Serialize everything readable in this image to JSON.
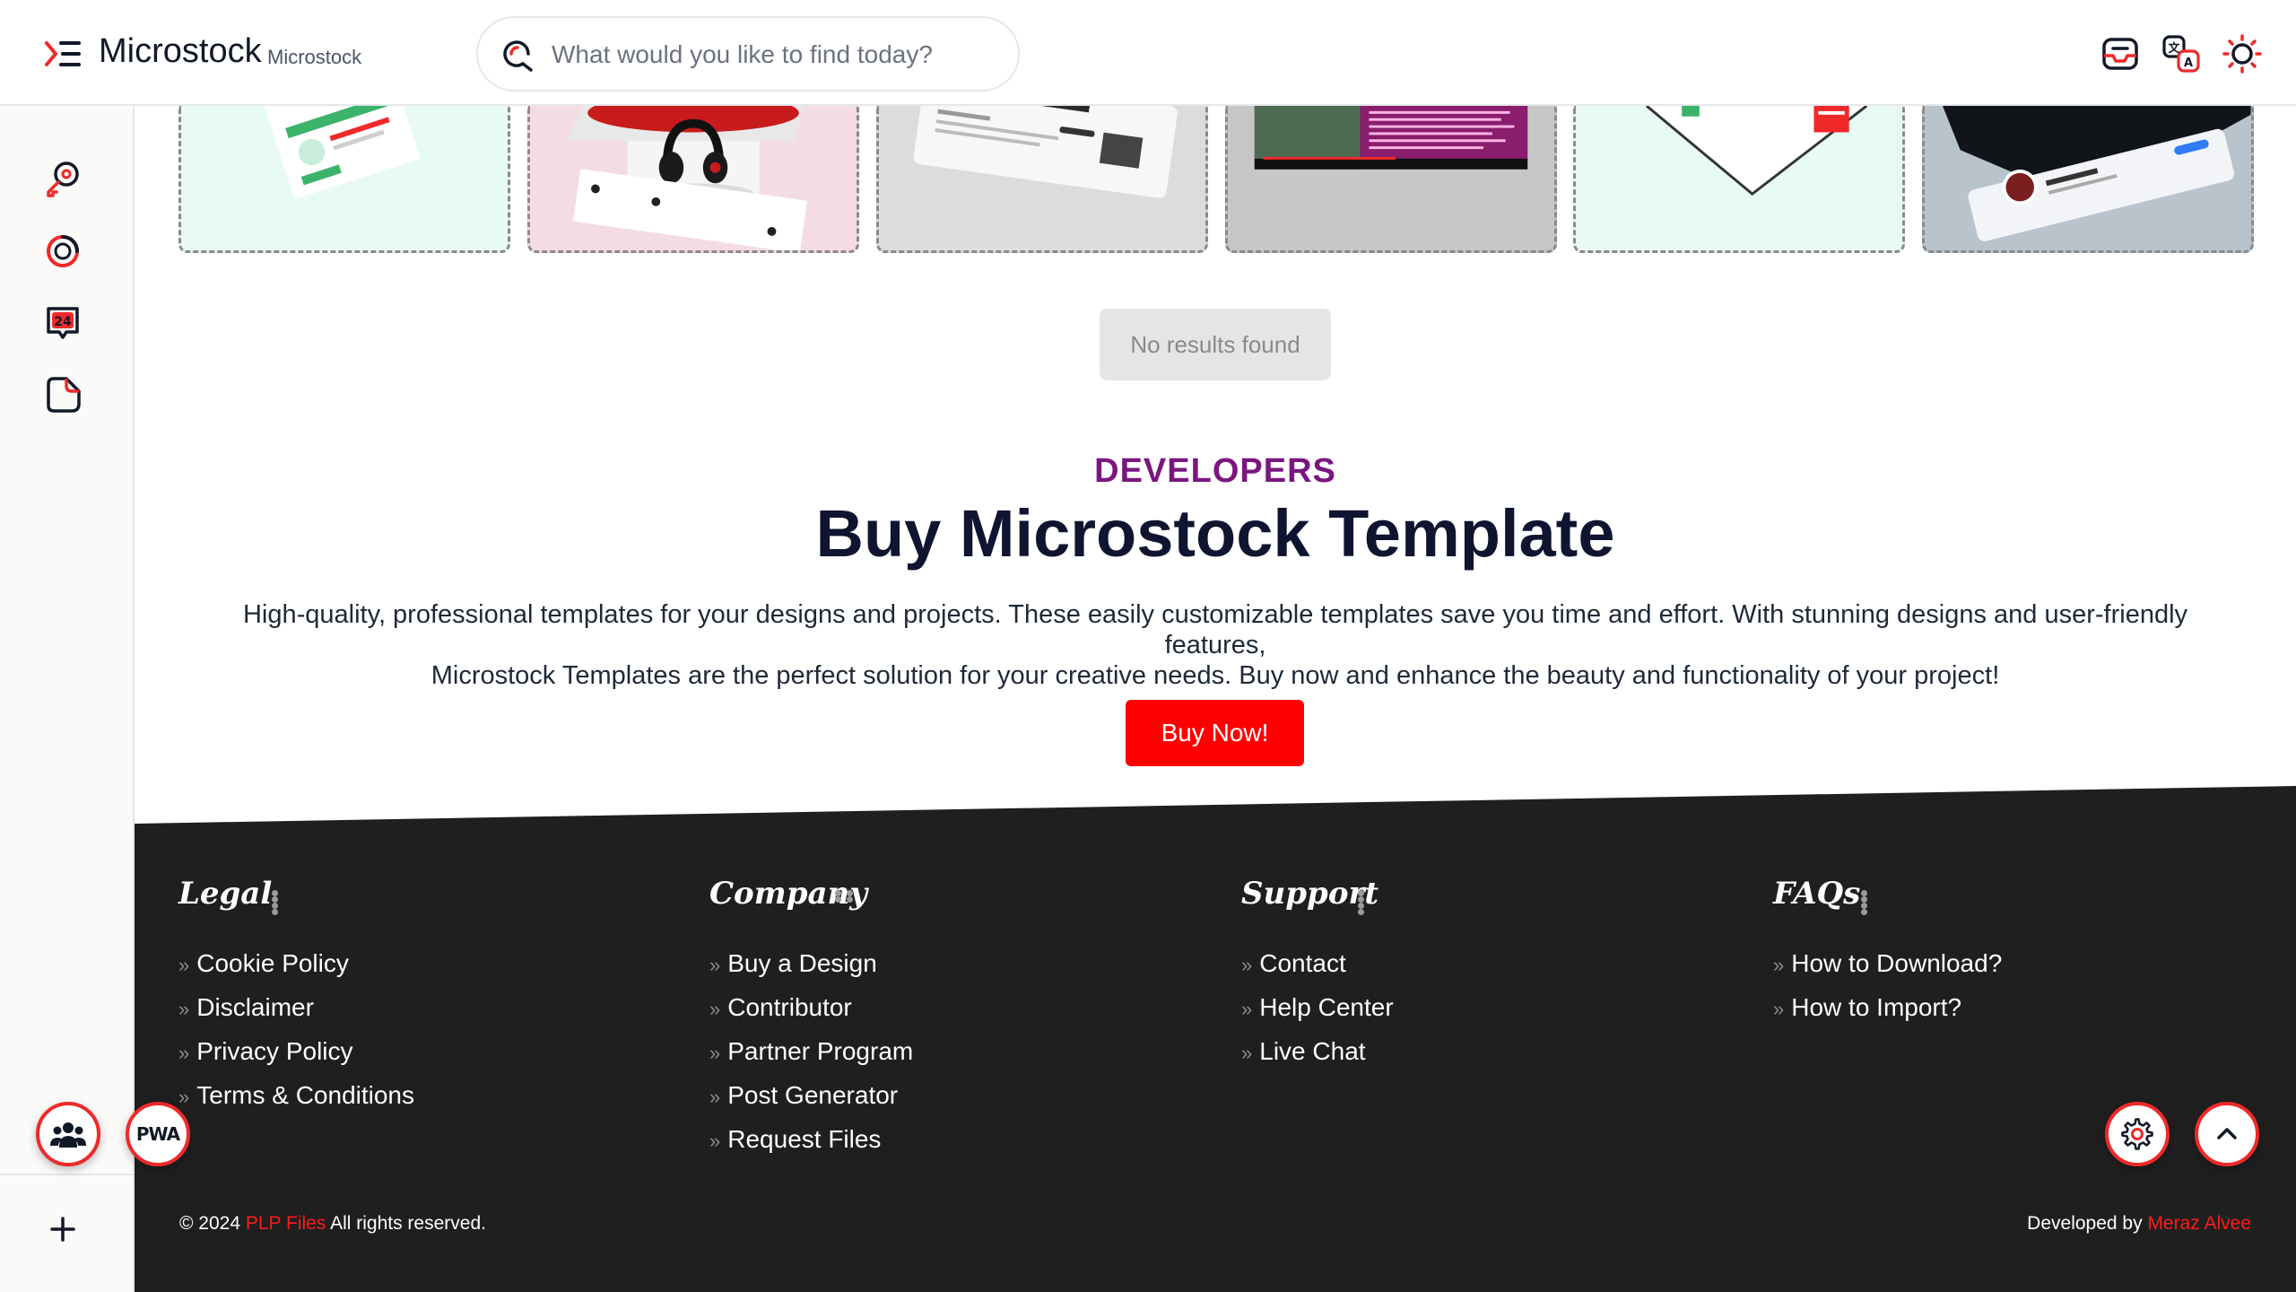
{
  "header": {
    "brand": "Microstock",
    "brand_sub": "Microstock",
    "search_placeholder": "What would you like to find today?",
    "icons": [
      "inbox-icon",
      "translate-icon",
      "theme-sun-icon"
    ]
  },
  "sidebar": {
    "items": [
      "key-search-icon",
      "loading-ring-icon",
      "support-24-icon",
      "sticky-note-icon"
    ],
    "support_badge": "24",
    "bottom_add": "+"
  },
  "floating": {
    "community_icon": "users-icon",
    "pwa_label": "PWA",
    "settings_icon": "gear-icon",
    "scroll_top_icon": "chevron-up-icon"
  },
  "results": {
    "no_results": "No results found"
  },
  "hero": {
    "eyebrow": "DEVELOPERS",
    "title": "Buy Microstock Template",
    "description_line1": "High-quality, professional templates for your designs and projects. These easily customizable templates save you time and effort. With stunning designs and user-friendly features,",
    "description_line2": "Microstock Templates are the perfect solution for your creative needs. Buy now and enhance the beauty and functionality of your project!",
    "cta": "Buy Now!"
  },
  "footer": {
    "columns": [
      {
        "heading": "Legal",
        "links": [
          "Cookie Policy",
          "Disclaimer",
          "Privacy Policy",
          "Terms & Conditions"
        ]
      },
      {
        "heading": "Company",
        "links": [
          "Buy a Design",
          "Contributor",
          "Partner Program",
          "Post Generator",
          "Request Files"
        ]
      },
      {
        "heading": "Support",
        "links": [
          "Contact",
          "Help Center",
          "Live Chat"
        ]
      },
      {
        "heading": "FAQs",
        "links": [
          "How to Download?",
          "How to Import?"
        ]
      }
    ],
    "copyright_prefix": "© 2024",
    "copyright_link": "PLP Files",
    "copyright_suffix": "All rights reserved.",
    "developed_by": "Developed by",
    "developer_name": "Meraz Alvee"
  },
  "colors": {
    "accent": "#ff0000",
    "eyebrow": "#7a1680",
    "footer_bg": "#1f1f1f",
    "title": "#0f1530"
  }
}
